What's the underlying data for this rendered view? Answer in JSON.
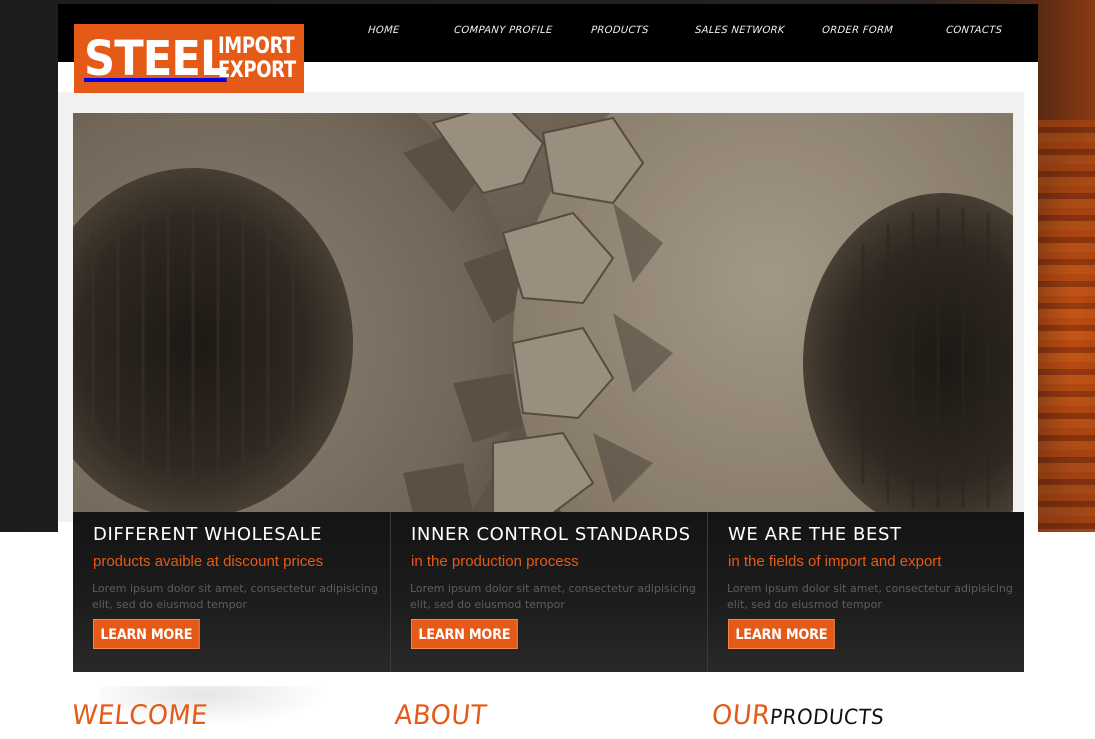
{
  "brand": {
    "logo_main": "STEEL",
    "logo_line1": "IMPORT",
    "logo_line2": "EXPORT",
    "accent_color": "#e55a17"
  },
  "nav": {
    "items": [
      {
        "label": "HOME"
      },
      {
        "label": "COMPANY PROFILE"
      },
      {
        "label": "PRODUCTS"
      },
      {
        "label": "SALES NETWORK"
      },
      {
        "label": "ORDER FORM"
      },
      {
        "label": "CONTACTS"
      }
    ]
  },
  "hero": {
    "image": "gears-photo"
  },
  "features": [
    {
      "title": "DIFFERENT WHOLESALE",
      "subtitle": "products avaible at discount prices",
      "text": "Lorem ipsum dolor sit amet, consectetur adipisicing elit, sed do eiusmod tempor",
      "button": "LEARN MORE"
    },
    {
      "title": "INNER CONTROL STANDARDS",
      "subtitle": "in the production process",
      "text": "Lorem ipsum dolor sit amet, consectetur adipisicing elit, sed do eiusmod tempor",
      "button": "LEARN MORE"
    },
    {
      "title": "WE ARE THE BEST",
      "subtitle": "in the fields of import and export",
      "text": "Lorem ipsum dolor sit amet, consectetur adipisicing elit, sed do eiusmod tempor",
      "button": "LEARN MORE"
    }
  ],
  "sections": {
    "welcome": "WELCOME",
    "about": "ABOUT",
    "our": "OUR",
    "products": "PRODUCTS"
  }
}
